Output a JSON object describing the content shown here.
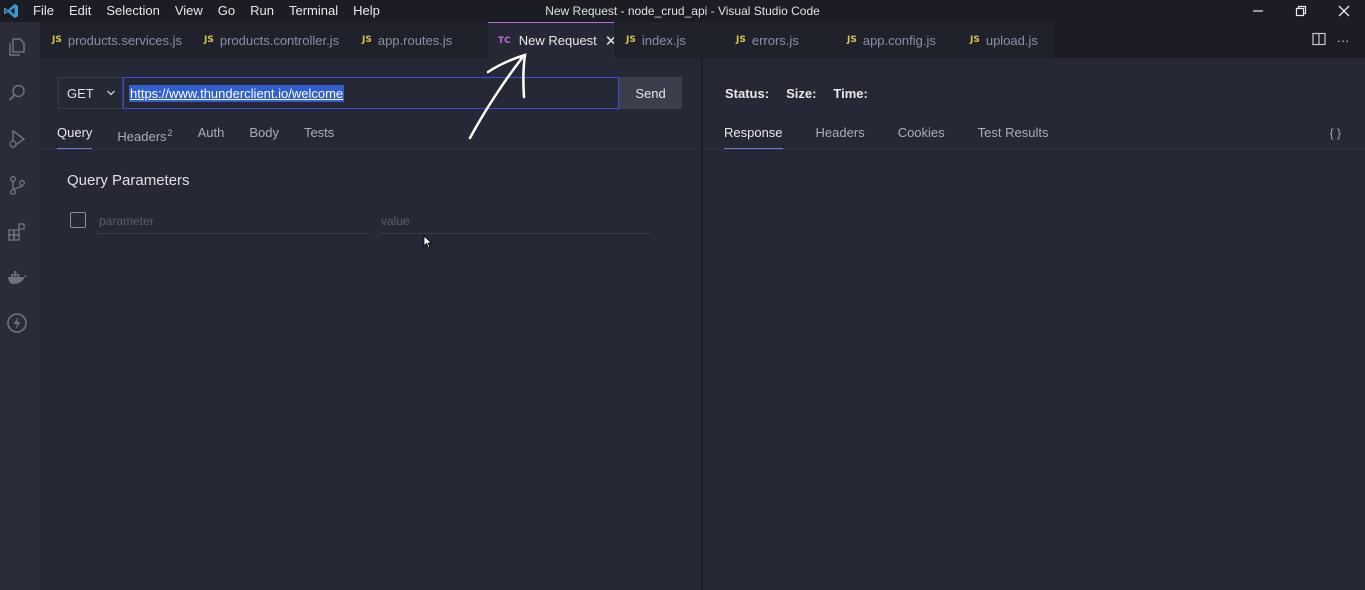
{
  "window": {
    "title": "New Request - node_crud_api - Visual Studio Code",
    "menu": [
      "File",
      "Edit",
      "Selection",
      "View",
      "Go",
      "Run",
      "Terminal",
      "Help"
    ]
  },
  "activity_icons": [
    "explorer-icon",
    "search-icon",
    "run-debug-icon",
    "source-control-icon",
    "extensions-icon",
    "docker-icon",
    "thunder-client-icon"
  ],
  "tabs": [
    {
      "badge": "JS",
      "label": "products.services.js"
    },
    {
      "badge": "JS",
      "label": "products.controller.js"
    },
    {
      "badge": "JS",
      "label": "app.routes.js"
    },
    {
      "badge": "TC",
      "label": "New Request",
      "active": true
    },
    {
      "badge": "JS",
      "label": "index.js"
    },
    {
      "badge": "JS",
      "label": "errors.js"
    },
    {
      "badge": "JS",
      "label": "app.config.js"
    },
    {
      "badge": "JS",
      "label": "upload.js"
    }
  ],
  "request": {
    "method": "GET",
    "url": "https://www.thunderclient.io/welcome",
    "send_label": "Send",
    "tabs": [
      {
        "label": "Query",
        "active": true
      },
      {
        "label": "Headers",
        "count": "2"
      },
      {
        "label": "Auth"
      },
      {
        "label": "Body"
      },
      {
        "label": "Tests"
      }
    ],
    "query_params": {
      "title": "Query Parameters",
      "param_placeholder": "parameter",
      "value_placeholder": "value"
    }
  },
  "response": {
    "status_label": "Status:",
    "size_label": "Size:",
    "time_label": "Time:",
    "tabs": [
      {
        "label": "Response",
        "active": true
      },
      {
        "label": "Headers"
      },
      {
        "label": "Cookies"
      },
      {
        "label": "Test Results"
      }
    ],
    "format_icon": "{ }"
  },
  "colors": {
    "accent_tab": "#b96ad9",
    "url_selection": "#2f5fd0",
    "js_badge": "#d9c54a"
  }
}
